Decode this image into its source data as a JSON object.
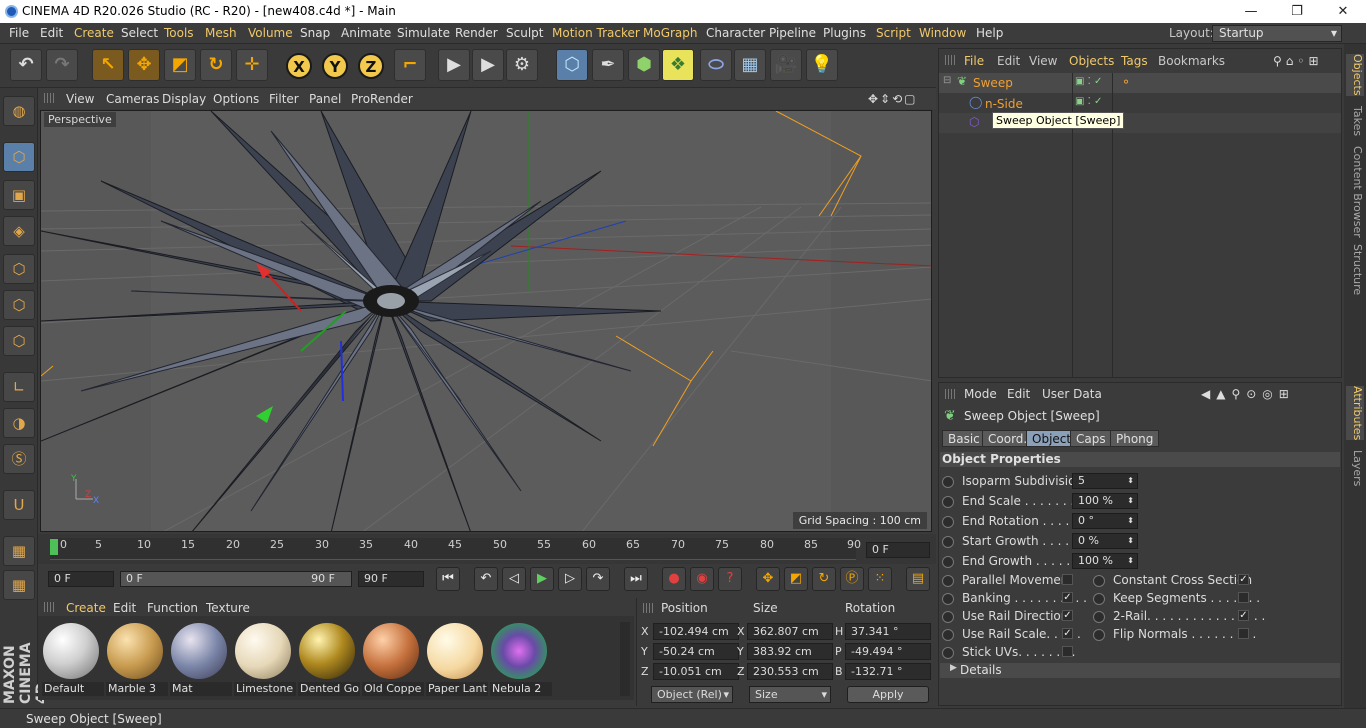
{
  "titlebar": {
    "title": "CINEMA 4D R20.026 Studio (RC - R20) - [new408.c4d *] - Main",
    "min": "—",
    "max": "❐",
    "close": "✕"
  },
  "menubar": {
    "items": [
      "File",
      "Edit",
      "Create",
      "Select",
      "Tools",
      "Mesh",
      "Volume",
      "Snap",
      "Animate",
      "Simulate",
      "Render",
      "Sculpt",
      "Motion Tracker",
      "MoGraph",
      "Character",
      "Pipeline",
      "Plugins",
      "Script",
      "Window",
      "Help"
    ],
    "layout_label": "Layout:",
    "layout_value": "Startup"
  },
  "toolbar": {
    "x": "X",
    "y": "Y",
    "z": "Z"
  },
  "viewport": {
    "menu": [
      "View",
      "Cameras",
      "Display",
      "Options",
      "Filter",
      "Panel",
      "ProRender"
    ],
    "label": "Perspective",
    "grid_spacing": "Grid Spacing : 100 cm"
  },
  "timeline": {
    "ticks": [
      "0",
      "5",
      "10",
      "15",
      "20",
      "25",
      "30",
      "35",
      "40",
      "45",
      "50",
      "55",
      "60",
      "65",
      "70",
      "75",
      "80",
      "85",
      "90"
    ],
    "current_frame": "0 F",
    "start": "0 F",
    "range_start": "0 F",
    "range_end": "90 F",
    "end": "90 F"
  },
  "materials": {
    "menu": [
      "Create",
      "Edit",
      "Function",
      "Texture"
    ],
    "items": [
      "Default",
      "Marble 3",
      "Mat",
      "Limestone",
      "Dented Go",
      "Old Coppe",
      "Paper Lant",
      "Nebula 2"
    ]
  },
  "coords": {
    "headers": {
      "position": "Position",
      "size": "Size",
      "rotation": "Rotation"
    },
    "rows": [
      {
        "axis": "X",
        "pos": "-102.494 cm",
        "size_axis": "X",
        "size": "362.807 cm",
        "rot_axis": "H",
        "rot": "37.341 °"
      },
      {
        "axis": "Y",
        "pos": "-50.24 cm",
        "size_axis": "Y",
        "size": "383.92 cm",
        "rot_axis": "P",
        "rot": "-49.494 °"
      },
      {
        "axis": "Z",
        "pos": "-10.051 cm",
        "size_axis": "Z",
        "size": "230.553 cm",
        "rot_axis": "B",
        "rot": "-132.71 °"
      }
    ],
    "mode": "Object (Rel)",
    "size_mode": "Size",
    "apply": "Apply"
  },
  "objects": {
    "menu": [
      "File",
      "Edit",
      "View",
      "Objects",
      "Tags",
      "Bookmarks"
    ],
    "tree": [
      {
        "name": "Sweep"
      },
      {
        "name": "n-Side"
      }
    ],
    "tooltip": "Sweep Object [Sweep]"
  },
  "attributes": {
    "menu": [
      "Mode",
      "Edit",
      "User Data"
    ],
    "title": "Sweep Object [Sweep]",
    "tabs": [
      "Basic",
      "Coord.",
      "Object",
      "Caps",
      "Phong"
    ],
    "section": "Object Properties",
    "fields": [
      {
        "label": "Isoparm Subdivision",
        "value": "5"
      },
      {
        "label": "End Scale . . . . . . . . . .",
        "value": "100 %"
      },
      {
        "label": "End Rotation . . . . . .",
        "value": "0 °"
      },
      {
        "label": "Start Growth . . . . . .",
        "value": "0 %"
      },
      {
        "label": "End Growth . . . . . . .",
        "value": "100 %"
      }
    ],
    "checks_left": [
      {
        "label": "Parallel Movement",
        "checked": false
      },
      {
        "label": "Banking . . . . . . . . . .",
        "checked": true
      },
      {
        "label": "Use Rail Direction",
        "checked": true
      },
      {
        "label": "Use Rail Scale. . . . .",
        "checked": true
      },
      {
        "label": "Stick UVs. . . . . . . .",
        "checked": false
      }
    ],
    "checks_right": [
      {
        "label": "Constant Cross Section",
        "checked": true
      },
      {
        "label": "Keep Segments . . . . . . .",
        "checked": false
      },
      {
        "label": "2-Rail. . . . . . . . . . . . . . . .",
        "checked": true
      },
      {
        "label": "Flip Normals . . . . . . . . .",
        "checked": false
      }
    ],
    "details": "Details"
  },
  "right_tabs": [
    "Objects",
    "Takes",
    "Content Browser",
    "Structure",
    "Attributes",
    "Layers"
  ],
  "status": "Sweep Object [Sweep]"
}
